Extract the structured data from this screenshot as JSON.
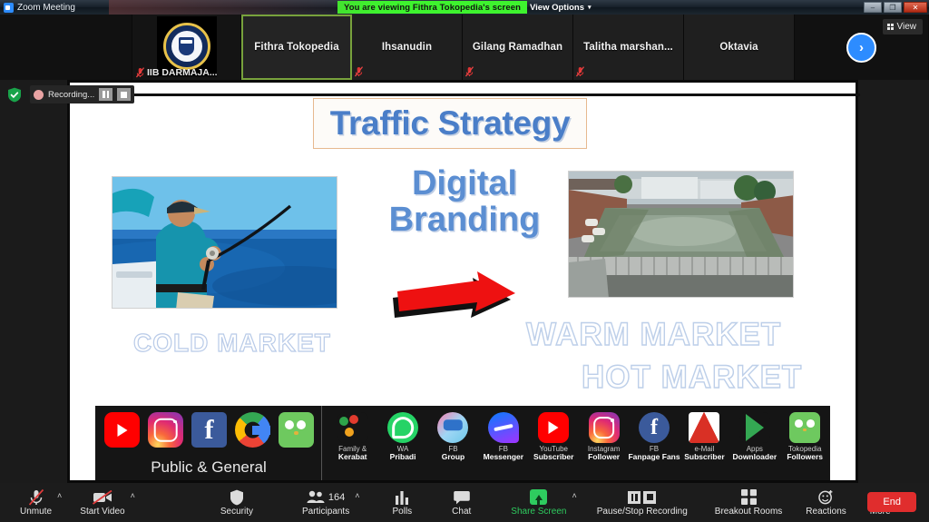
{
  "window": {
    "app_title": "Zoom Meeting",
    "app_icon": "zoom-icon",
    "viewing_banner": "You are viewing Fithra Tokopedia's screen",
    "view_options_label": "View Options",
    "view_options_caret": "⌵",
    "minimize": "–",
    "maximize": "❐",
    "close": "✕"
  },
  "thumbnails": {
    "view_button_label": "View",
    "next_arrow": "›",
    "participants": [
      {
        "name": "IIB DARMAJA...",
        "avatar": "institute-crest",
        "muted": true,
        "active": false
      },
      {
        "name": "Fithra Tokopedia",
        "avatar": "",
        "muted": false,
        "active": true
      },
      {
        "name": "Ihsanudin",
        "avatar": "",
        "muted": true,
        "active": false
      },
      {
        "name": "Gilang Ramadhan",
        "avatar": "",
        "muted": true,
        "active": false
      },
      {
        "name": "Talitha  marshan...",
        "avatar": "",
        "muted": true,
        "active": false
      },
      {
        "name": "Oktavia",
        "avatar": "",
        "muted": true,
        "active": false
      }
    ]
  },
  "recording_bar": {
    "status_label": "Recording...",
    "pause_icon": "pause-icon",
    "stop_icon": "stop-icon",
    "shield_icon": "green-shield-icon"
  },
  "slide": {
    "title": "Traffic Strategy",
    "center_heading_line1": "Digital",
    "center_heading_line2": "Branding",
    "arrow": "red-right-arrow",
    "left_photo_alt": "man deep sea fishing from boat",
    "right_photo_alt": "fish farming pond",
    "cold_market": "COLD MARKET",
    "warm_market": "WARM MARKET",
    "hot_market": "HOT MARKET",
    "general_caption": "Public & General",
    "general_icons": [
      {
        "icon": "youtube-icon",
        "name": "YouTube"
      },
      {
        "icon": "instagram-icon",
        "name": "Instagram"
      },
      {
        "icon": "facebook-icon",
        "name": "Facebook"
      },
      {
        "icon": "google-icon",
        "name": "Google"
      },
      {
        "icon": "tokopedia-icon",
        "name": "Tokopedia"
      }
    ],
    "targeted_icons": [
      {
        "icon": "family-icon",
        "line1": "Family &",
        "line2": "Kerabat"
      },
      {
        "icon": "whatsapp-icon",
        "line1": "WA",
        "line2": "Pribadi"
      },
      {
        "icon": "fb-group-icon",
        "line1": "FB",
        "line2": "Group"
      },
      {
        "icon": "messenger-icon",
        "line1": "FB",
        "line2": "Messenger"
      },
      {
        "icon": "youtube-icon",
        "line1": "YouTube",
        "line2": "Subscriber"
      },
      {
        "icon": "instagram-icon",
        "line1": "Instagram",
        "line2": "Follower"
      },
      {
        "icon": "fb-fanpage-icon",
        "line1": "FB",
        "line2": "Fanpage Fans"
      },
      {
        "icon": "gmail-icon",
        "line1": "e-Mail",
        "line2": "Subscriber"
      },
      {
        "icon": "play-store-icon",
        "line1": "Apps",
        "line2": "Downloader"
      },
      {
        "icon": "tokopedia-icon",
        "line1": "Tokopedia",
        "line2": "Followers"
      }
    ]
  },
  "toolbar": {
    "unmute_label": "Unmute",
    "start_video_label": "Start Video",
    "security_label": "Security",
    "participants_label": "Participants",
    "participants_count": "164",
    "polls_label": "Polls",
    "chat_label": "Chat",
    "share_screen_label": "Share Screen",
    "recording_label": "Pause/Stop Recording",
    "breakout_label": "Breakout Rooms",
    "reactions_label": "Reactions",
    "more_label": "More",
    "more_glyph": "•••",
    "end_label": "End",
    "caret_glyph": "˄"
  },
  "colors": {
    "accent_blue": "#2d8cff",
    "banner_green": "#3ef32e",
    "share_green": "#2ecc5f",
    "end_red": "#e02d2d",
    "active_border": "#78a23c",
    "slide_title_blue": "#4a7ec8"
  }
}
